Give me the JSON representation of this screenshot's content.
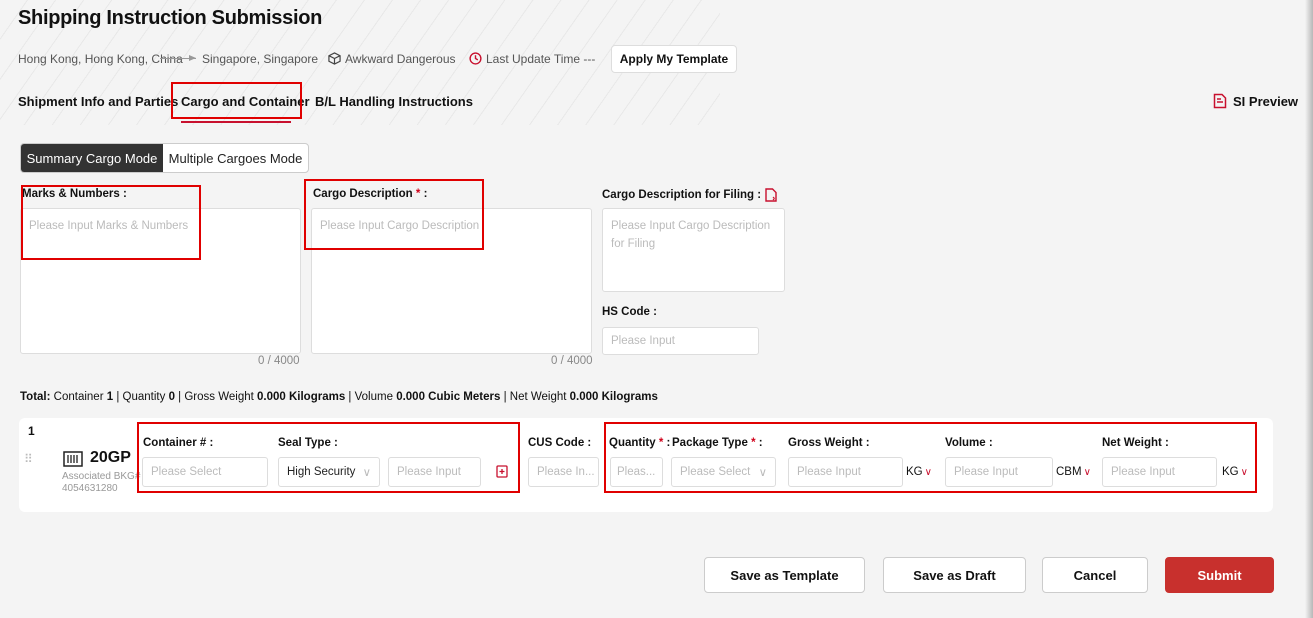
{
  "header": {
    "title": "Shipping Instruction Submission",
    "origin": "Hong Kong, Hong Kong, China",
    "destination": "Singapore, Singapore",
    "cargo_flag": "Awkward Dangerous",
    "last_update": "Last Update Time ---",
    "apply_template_label": "Apply My Template"
  },
  "tabs": [
    {
      "label": "Shipment Info and Parties"
    },
    {
      "label": "Cargo and Container"
    },
    {
      "label": "B/L Handling Instructions"
    }
  ],
  "si_preview_label": "SI Preview",
  "modes": [
    {
      "label": "Summary Cargo Mode"
    },
    {
      "label": "Multiple Cargoes Mode"
    }
  ],
  "cargo": {
    "marks": {
      "label": "Marks & Numbers :",
      "placeholder": "Please Input  Marks & Numbers",
      "counter": "0 / 4000"
    },
    "description": {
      "label": "Cargo Description",
      "suffix": " :",
      "required": "*",
      "placeholder": "Please Input  Cargo Description",
      "counter": "0 / 4000"
    },
    "filing": {
      "label": "Cargo Description for Filing :",
      "placeholder": "Please Input  Cargo Description for Filing"
    },
    "hs_code": {
      "label": "HS Code :",
      "placeholder": "Please Input"
    }
  },
  "totals": {
    "total_label": "Total:",
    "container_label": "Container",
    "container_value": "1",
    "quantity_label": "Quantity",
    "quantity_value": "0",
    "gross_label": "Gross Weight",
    "gross_value": "0.000 Kilograms",
    "volume_label": "Volume",
    "volume_value": "0.000 Cubic Meters",
    "net_label": "Net Weight",
    "net_value": "0.000 Kilograms"
  },
  "container_row": {
    "index": "1",
    "type": "20GP",
    "associated_label": "Associated BKG#",
    "booking_number": "4054631280",
    "container_no": {
      "label": "Container # :",
      "placeholder": "Please Select"
    },
    "seal_type": {
      "label": "Seal Type :",
      "value": "High Security",
      "input_placeholder": "Please Input"
    },
    "cus_code": {
      "label": "CUS Code :",
      "placeholder": "Please In..."
    },
    "quantity": {
      "label": "Quantity",
      "required": "*",
      "suffix": " :",
      "placeholder": "Pleas..."
    },
    "package_type": {
      "label": "Package Type",
      "required": "*",
      "suffix": " :",
      "placeholder": "Please Select"
    },
    "gross_weight": {
      "label": "Gross Weight :",
      "placeholder": "Please Input",
      "unit": "KG"
    },
    "volume": {
      "label": "Volume :",
      "placeholder": "Please Input",
      "unit": "CBM"
    },
    "net_weight": {
      "label": "Net Weight :",
      "placeholder": "Please Input",
      "unit": "KG"
    }
  },
  "footer": {
    "save_template": "Save as Template",
    "save_draft": "Save as Draft",
    "cancel": "Cancel",
    "submit": "Submit"
  },
  "colors": {
    "accent": "#c8102e",
    "highlight_box": "#e00000",
    "submit": "#c8302d"
  }
}
